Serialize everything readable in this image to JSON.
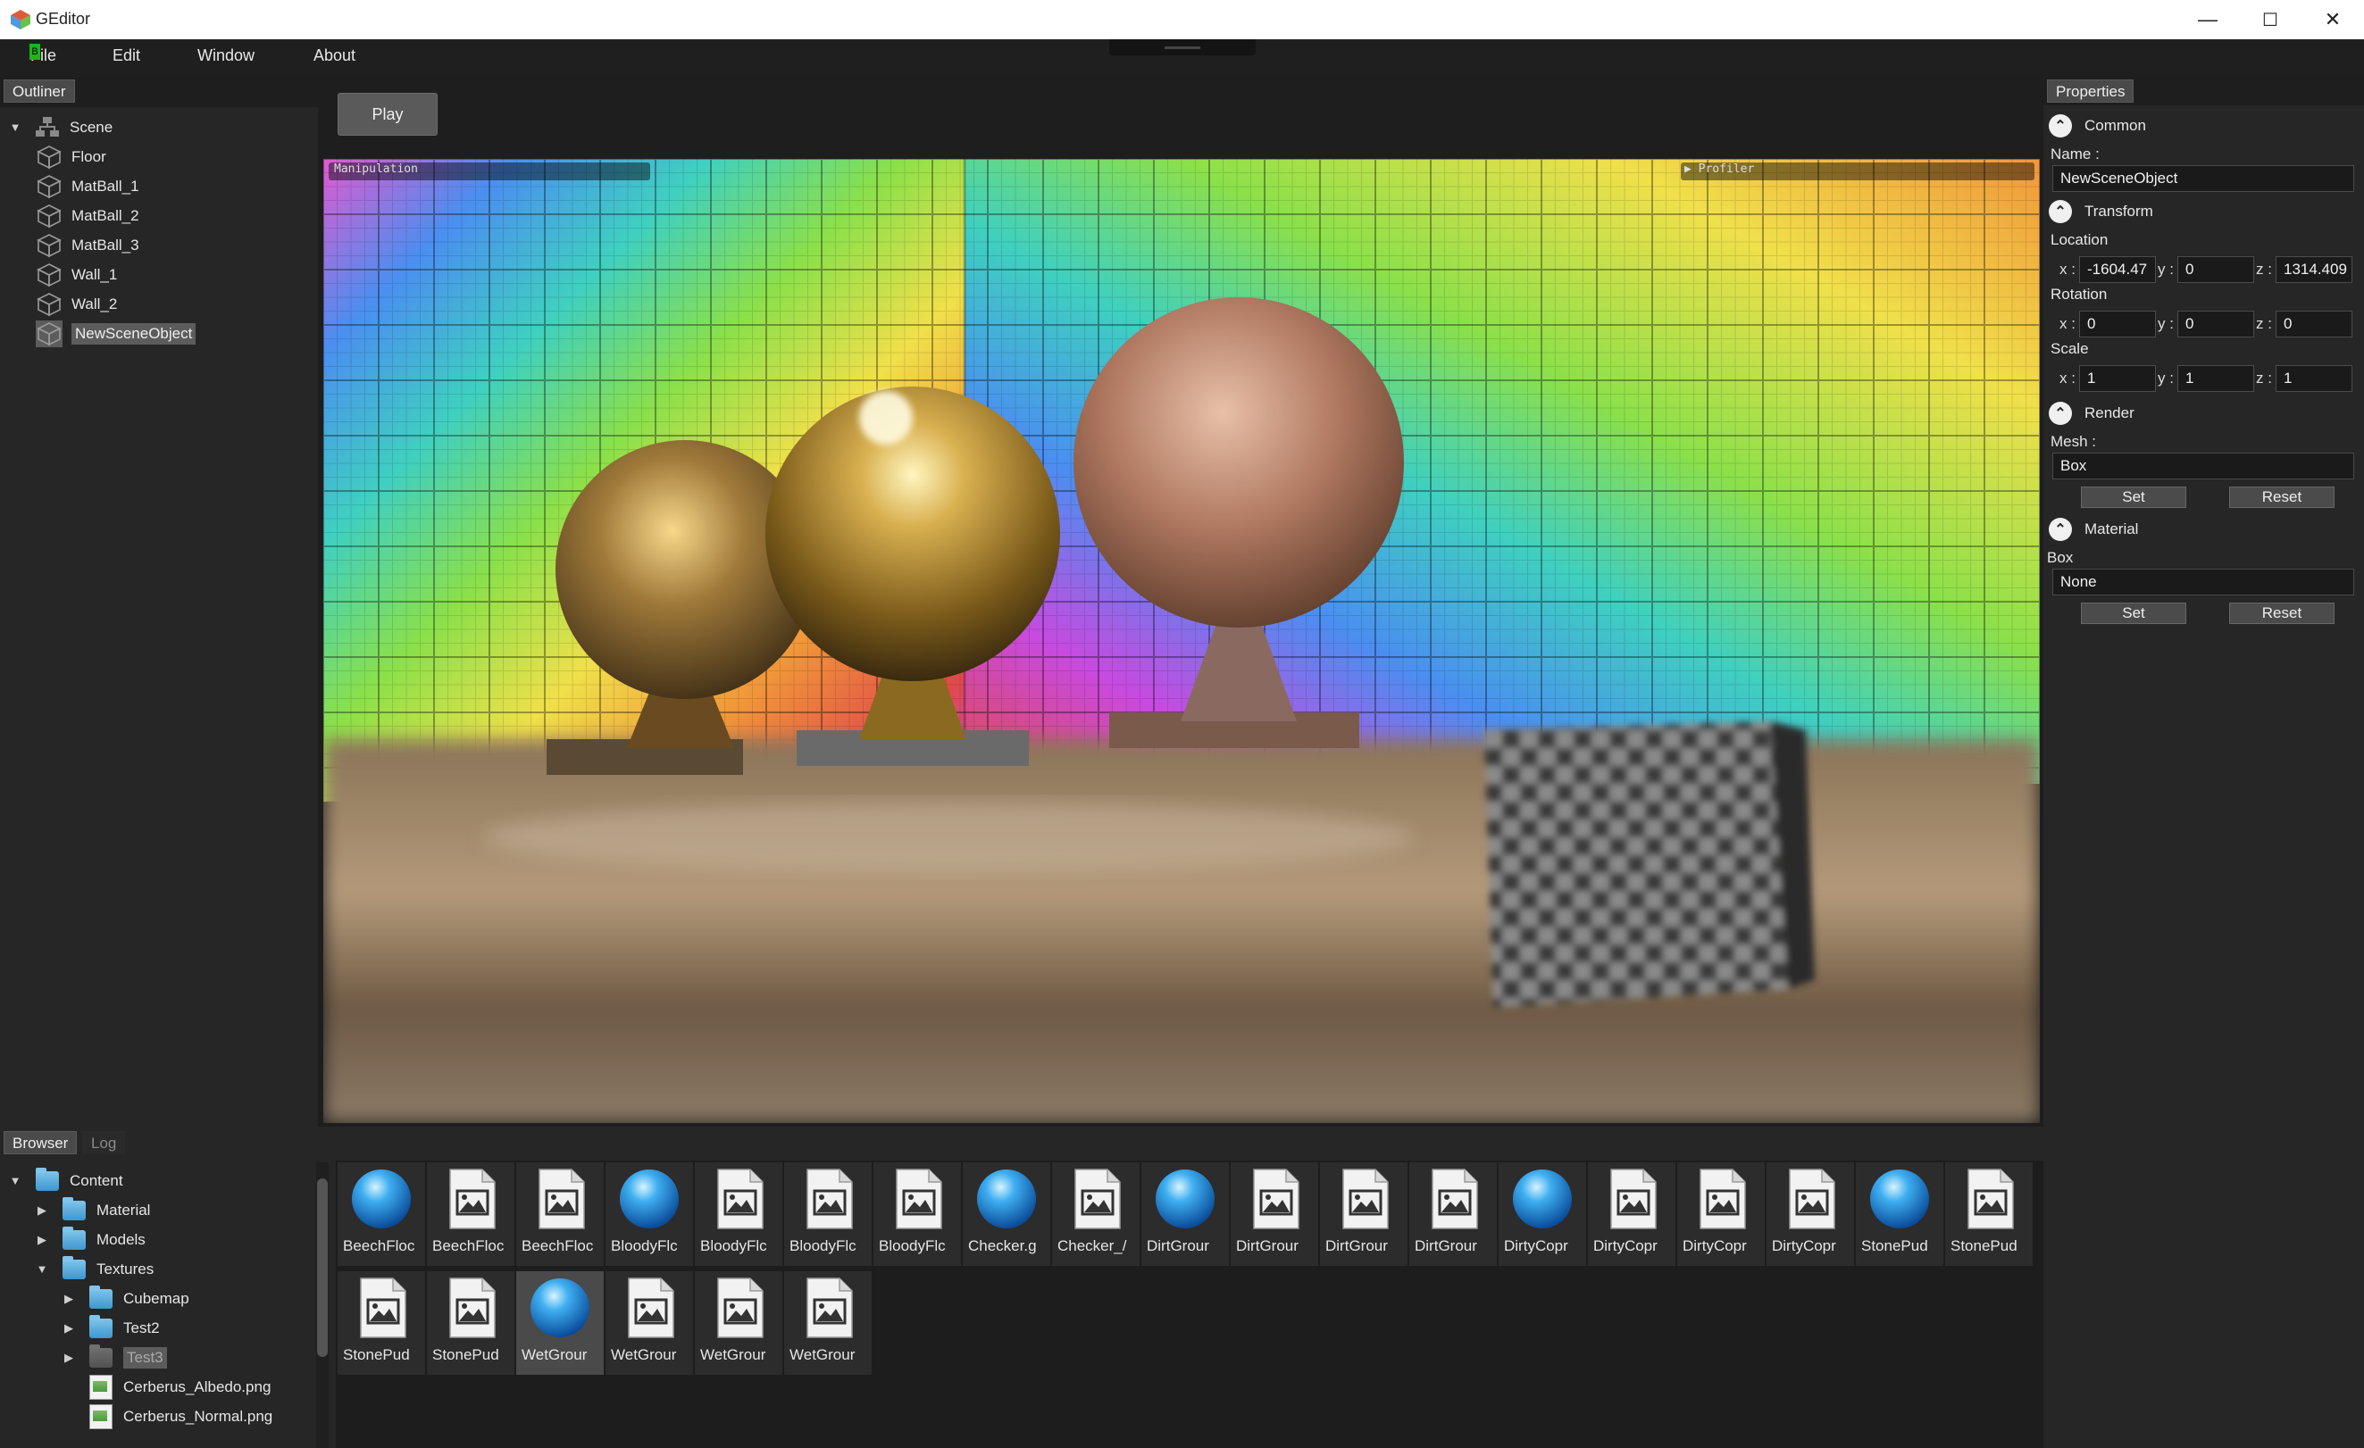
{
  "window": {
    "title": "GEditor",
    "controls": {
      "minimize": "—",
      "maximize": "☐",
      "close": "✕"
    }
  },
  "menu": [
    "File",
    "Edit",
    "Window",
    "About"
  ],
  "outliner": {
    "tab": "Outliner",
    "root": "Scene",
    "items": [
      "Floor",
      "MatBall_1",
      "MatBall_2",
      "MatBall_3",
      "Wall_1",
      "Wall_2",
      "NewSceneObject"
    ],
    "selected": "NewSceneObject"
  },
  "viewport": {
    "play_label": "Play",
    "overlay_left": "Manipulation",
    "overlay_right": "▶ Profiler"
  },
  "properties": {
    "tab": "Properties",
    "common": {
      "header": "Common",
      "name_label": "Name :",
      "name_value": "NewSceneObject"
    },
    "transform": {
      "header": "Transform",
      "location_label": "Location",
      "location": {
        "x": "-1604.47",
        "y": "0",
        "z": "1314.409"
      },
      "rotation_label": "Rotation",
      "rotation": {
        "x": "0",
        "y": "0",
        "z": "0"
      },
      "scale_label": "Scale",
      "scale": {
        "x": "1",
        "y": "1",
        "z": "1"
      },
      "axis_x": "x :",
      "axis_y": "y :",
      "axis_z": "z :"
    },
    "render": {
      "header": "Render",
      "mesh_label": "Mesh :",
      "mesh_value": "Box",
      "set": "Set",
      "reset": "Reset"
    },
    "material": {
      "header": "Material",
      "slot_label": "Box",
      "value": "None",
      "set": "Set",
      "reset": "Reset"
    }
  },
  "bottom": {
    "tabs": [
      "Browser",
      "Log"
    ],
    "tree": {
      "content": "Content",
      "material": "Material",
      "models": "Models",
      "textures": "Textures",
      "cubemap": "Cubemap",
      "test2": "Test2",
      "test3": "Test3",
      "file1": "Cerberus_Albedo.png",
      "file2": "Cerberus_Normal.png"
    },
    "assets": [
      {
        "label": "BeechFloc",
        "type": "material"
      },
      {
        "label": "BeechFloc",
        "type": "image"
      },
      {
        "label": "BeechFloc",
        "type": "image"
      },
      {
        "label": "BloodyFlc",
        "type": "material"
      },
      {
        "label": "BloodyFlc",
        "type": "image"
      },
      {
        "label": "BloodyFlc",
        "type": "image"
      },
      {
        "label": "BloodyFlc",
        "type": "image"
      },
      {
        "label": "Checker.g",
        "type": "material"
      },
      {
        "label": "Checker_/",
        "type": "image"
      },
      {
        "label": "DirtGrour",
        "type": "material"
      },
      {
        "label": "DirtGrour",
        "type": "image"
      },
      {
        "label": "DirtGrour",
        "type": "image"
      },
      {
        "label": "DirtGrour",
        "type": "image"
      },
      {
        "label": "DirtyCopr",
        "type": "material"
      },
      {
        "label": "DirtyCopr",
        "type": "image"
      },
      {
        "label": "DirtyCopr",
        "type": "image"
      },
      {
        "label": "DirtyCopr",
        "type": "image"
      },
      {
        "label": "StonePud",
        "type": "material"
      },
      {
        "label": "StonePud",
        "type": "image"
      },
      {
        "label": "StonePud",
        "type": "image"
      },
      {
        "label": "StonePud",
        "type": "image"
      },
      {
        "label": "WetGrour",
        "type": "material",
        "selected": true
      },
      {
        "label": "WetGrour",
        "type": "image"
      },
      {
        "label": "WetGrour",
        "type": "image"
      },
      {
        "label": "WetGrour",
        "type": "image"
      }
    ]
  },
  "colors": {
    "bg": "#1e1e1e",
    "panel": "#262626",
    "accent_blue": "#3e97cf",
    "selection": "#5c5c5c"
  }
}
